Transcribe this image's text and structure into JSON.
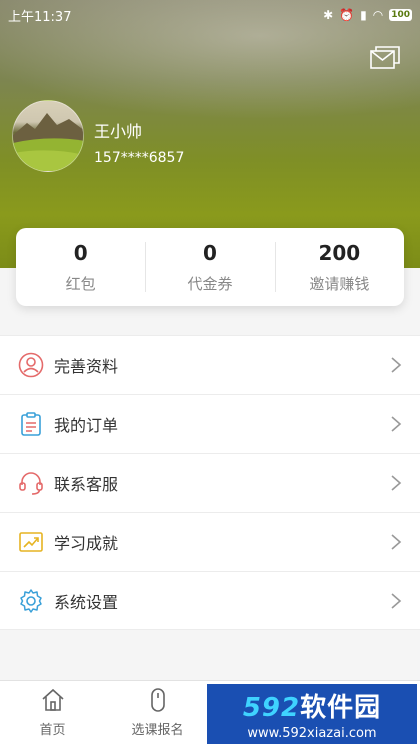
{
  "status_bar": {
    "time": "上午11:37",
    "battery": "100"
  },
  "header": {
    "message_icon": "message-envelope-icon"
  },
  "profile": {
    "name": "王小帅",
    "phone": "157****6857"
  },
  "stats": [
    {
      "value": "0",
      "label": "红包"
    },
    {
      "value": "0",
      "label": "代金券"
    },
    {
      "value": "200",
      "label": "邀请赚钱"
    }
  ],
  "menu": [
    {
      "label": "完善资料",
      "icon": "user-profile-icon",
      "color": "#e46a6a"
    },
    {
      "label": "我的订单",
      "icon": "order-clipboard-icon",
      "color": "#3aa0d8"
    },
    {
      "label": "联系客服",
      "icon": "headset-icon",
      "color": "#e46a6a"
    },
    {
      "label": "学习成就",
      "icon": "achievement-chart-icon",
      "color": "#e6b422"
    },
    {
      "label": "系统设置",
      "icon": "settings-gear-icon",
      "color": "#3aa0d8"
    }
  ],
  "tabbar": [
    {
      "label": "首页",
      "icon": "home-icon"
    },
    {
      "label": "选课报名",
      "icon": "mouse-icon"
    }
  ],
  "watermark": {
    "title_num": "592",
    "title_text": "软件园",
    "url": "www.592xiazai.com"
  }
}
